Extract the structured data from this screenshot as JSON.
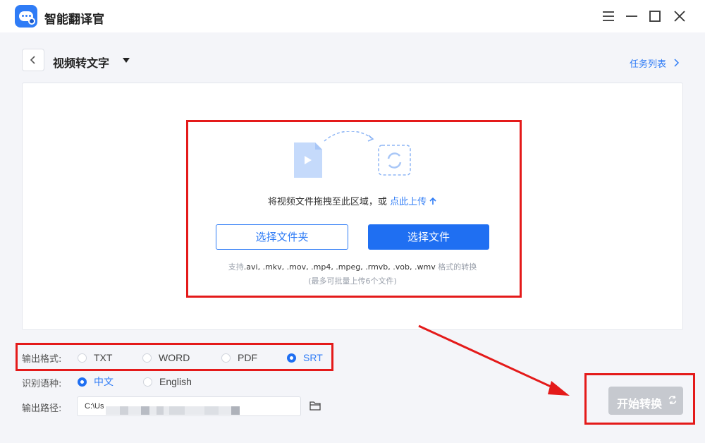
{
  "app": {
    "title": "智能翻译官"
  },
  "header": {
    "page_title": "视频转文字",
    "task_list": "任务列表"
  },
  "upload": {
    "hint_text": "将视频文件拖拽至此区域，或 ",
    "hint_link": "点此上传",
    "select_folder": "选择文件夹",
    "select_file": "选择文件",
    "support_prefix": "支持",
    "support_formats": ".avi, .mkv, .mov, .mp4, .mpeg, .rmvb, .vob, .wmv",
    "support_suffix": " 格式的转换",
    "limit_note": "(最多可批量上传6个文件)"
  },
  "output_format": {
    "label": "输出格式:",
    "options": [
      "TXT",
      "WORD",
      "PDF",
      "SRT"
    ],
    "selected": "SRT"
  },
  "language": {
    "label": "识别语种:",
    "options": [
      "中文",
      "English"
    ],
    "selected": "中文"
  },
  "output_path": {
    "label": "输出路径:",
    "value": "C:\\Us"
  },
  "actions": {
    "start": "开始转换"
  },
  "colors": {
    "accent": "#1f6ff2",
    "highlight": "#e41a1a",
    "disabled": "#c6c9cf"
  },
  "icons": [
    "app-logo-icon",
    "minimize-icon",
    "maximize-icon",
    "close-icon",
    "menu-icon",
    "back-icon",
    "chevron-right-icon",
    "video-file-icon",
    "convert-icon",
    "folder-icon",
    "refresh-icon"
  ]
}
